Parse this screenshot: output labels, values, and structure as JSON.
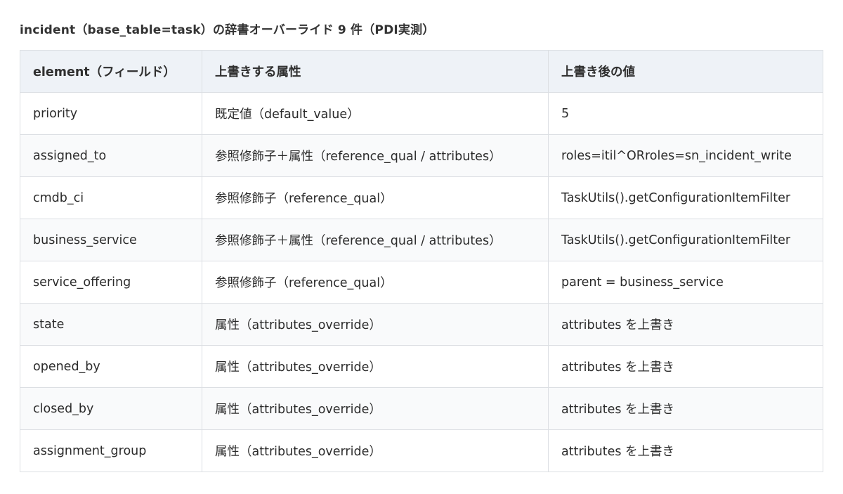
{
  "caption": "incident（base_table=task）の辞書オーバーライド 9 件（PDI実測）",
  "table": {
    "headers": [
      "element（フィールド）",
      "上書きする属性",
      "上書き後の値"
    ],
    "rows": [
      [
        "priority",
        "既定値（default_value）",
        "5"
      ],
      [
        "assigned_to",
        "参照修飾子＋属性（reference_qual / attributes）",
        "roles=itil^ORroles=sn_incident_write"
      ],
      [
        "cmdb_ci",
        "参照修飾子（reference_qual）",
        "TaskUtils().getConfigurationItemFilter"
      ],
      [
        "business_service",
        "参照修飾子＋属性（reference_qual / attributes）",
        "TaskUtils().getConfigurationItemFilter"
      ],
      [
        "service_offering",
        "参照修飾子（reference_qual）",
        "parent = business_service"
      ],
      [
        "state",
        "属性（attributes_override）",
        "attributes を上書き"
      ],
      [
        "opened_by",
        "属性（attributes_override）",
        "attributes を上書き"
      ],
      [
        "closed_by",
        "属性（attributes_override）",
        "attributes を上書き"
      ],
      [
        "assignment_group",
        "属性（attributes_override）",
        "attributes を上書き"
      ]
    ]
  },
  "colors": {
    "header_background": "#eef2f7",
    "border": "#dcdfe3",
    "text": "#2b2b2b"
  }
}
